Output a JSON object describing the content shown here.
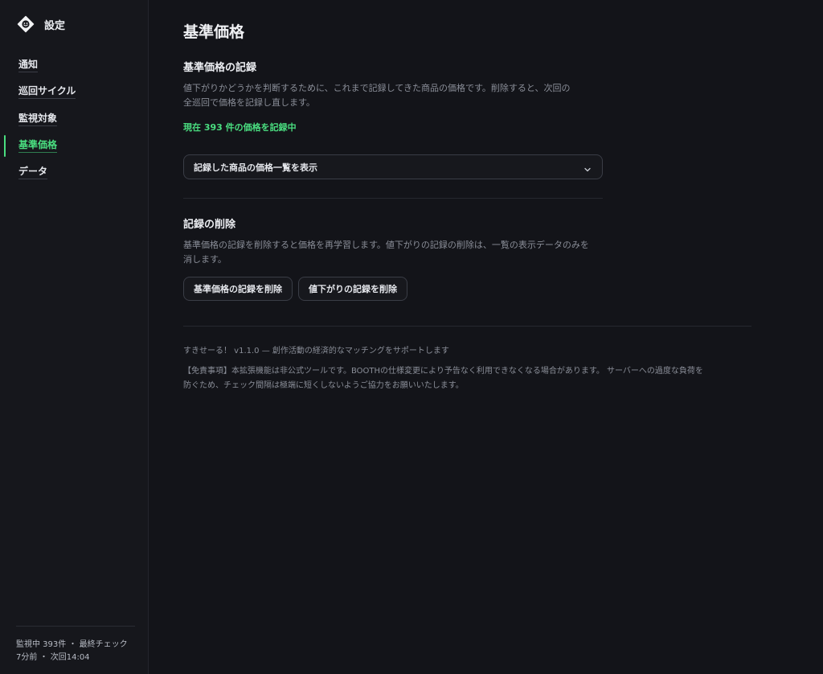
{
  "sidebar": {
    "title": "設定",
    "logo_icon": "tag-smile-icon",
    "items": [
      {
        "label": "通知",
        "active": false
      },
      {
        "label": "巡回サイクル",
        "active": false
      },
      {
        "label": "監視対象",
        "active": false
      },
      {
        "label": "基準価格",
        "active": true
      },
      {
        "label": "データ",
        "active": false
      }
    ],
    "footer_line1": "監視中 393件 ・ 最終チェック",
    "footer_line2": "7分前 ・ 次回14:04"
  },
  "main": {
    "page_title": "基準価格",
    "record_section": {
      "title": "基準価格の記録",
      "desc_line1": "値下がりかどうかを判断するために、これまで記録してきた商品の価格です。削除すると、次回の",
      "desc_line2": "全巡回で価格を記録し直します。",
      "status": "現在 393 件の価格を記録中",
      "dropdown_label": "記録した商品の価格一覧を表示",
      "dropdown_icon": "chevron-down-icon"
    },
    "delete_section": {
      "title": "記録の削除",
      "desc_line1": "基準価格の記録を削除すると価格を再学習します。値下がりの記録の削除は、一覧の表示データのみを",
      "desc_line2": "消します。",
      "btn_delete_base": "基準価格の記録を削除",
      "btn_delete_drops": "値下がりの記録を削除"
    },
    "about": "すきせーる！ v1.1.0 — 創作活動の経済的なマッチングをサポートします",
    "disclaimer_line1": "【免責事項】本拡張機能は非公式ツールです。BOOTHの仕様変更により予告なく利用できなくなる場合があります。 サーバーへの過度な負荷を",
    "disclaimer_line2": "防ぐため、チェック間隔は極端に短くしないようご協力をお願いいたします。"
  },
  "colors": {
    "accent": "#4ade80",
    "background": "#131419",
    "sidebar_background": "#16171c"
  }
}
